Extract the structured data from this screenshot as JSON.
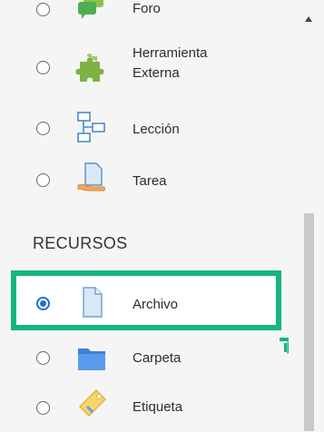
{
  "activities": [
    {
      "label": "Foro",
      "icon": "forum-icon",
      "selected": false
    },
    {
      "label": "Herramienta Externa",
      "icon": "puzzle-piece-icon",
      "selected": false
    },
    {
      "label": "Lección",
      "icon": "lesson-flowchart-icon",
      "selected": false
    },
    {
      "label": "Tarea",
      "icon": "assignment-hand-document-icon",
      "selected": false
    }
  ],
  "resources_heading": "RECURSOS",
  "resources": [
    {
      "label": "Archivo",
      "icon": "file-icon",
      "selected": true
    },
    {
      "label": "Carpeta",
      "icon": "folder-icon",
      "selected": false
    },
    {
      "label": "Etiqueta",
      "icon": "tag-icon",
      "selected": false
    }
  ],
  "colors": {
    "highlight": "#14b584",
    "radio_checked": "#1f6fd1"
  }
}
